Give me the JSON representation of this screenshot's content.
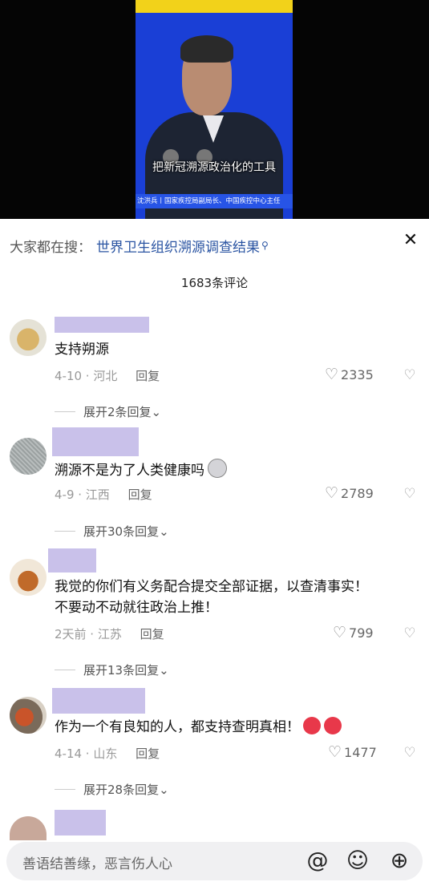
{
  "video": {
    "subtitle": "把新冠溯源政治化的工具",
    "lower_third": "沈洪兵丨国家疾控局副局长、中国疾控中心主任"
  },
  "search": {
    "label": "大家都在搜：",
    "query": "世界卫生组织溯源调查结果",
    "query_icon": "search-icon"
  },
  "close": {
    "icon": "close-icon",
    "glyph": "✕"
  },
  "comment_count": "1683条评论",
  "comments": [
    {
      "text_lines": [
        "支持朔源"
      ],
      "date_location": "4-10 · 河北",
      "reply_label": "回复",
      "likes": "2335",
      "expand_label": "展开2条回复"
    },
    {
      "text_lines": [
        "溯源不是为了人类健康吗"
      ],
      "date_location": "4-9 · 江西",
      "reply_label": "回复",
      "likes": "2789",
      "expand_label": "展开30条回复"
    },
    {
      "text_lines": [
        "我觉的你们有义务配合提交全部证据，以查清事实！",
        "不要动不动就往政治上推！"
      ],
      "date_location": "2天前 · 江苏",
      "reply_label": "回复",
      "likes": "799",
      "expand_label": "展开13条回复"
    },
    {
      "text_lines": [
        "作为一个有良知的人，都支持查明真相！"
      ],
      "date_location": "4-14 · 山东",
      "reply_label": "回复",
      "likes": "1477",
      "expand_label": "展开28条回复"
    }
  ],
  "input": {
    "placeholder": "善语结善缘，恶言伤人心",
    "mention_glyph": "@",
    "emoji_glyph": "☺",
    "add_glyph": "⊕"
  },
  "glyphs": {
    "heart": "♡",
    "dislike": "♡",
    "chevron": "⌄"
  },
  "colors": {
    "link": "#2a54a2",
    "name_redaction": "#c9c1ea",
    "video_bg": "#1a3fd6"
  }
}
